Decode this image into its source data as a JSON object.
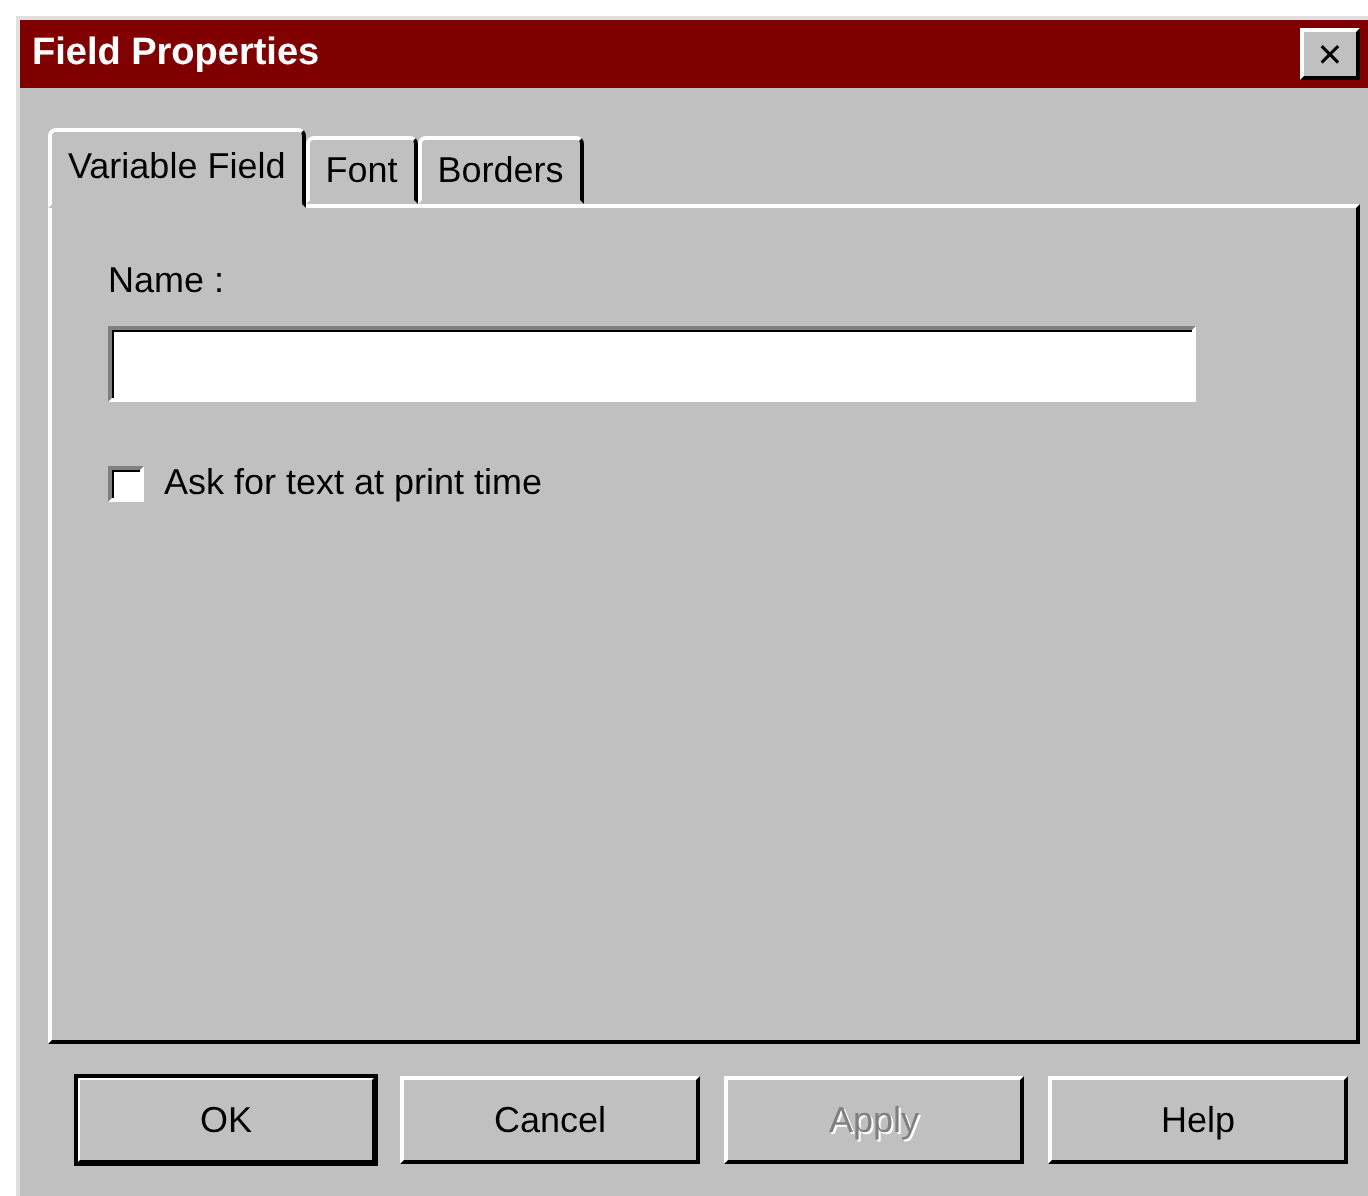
{
  "window": {
    "title": "Field Properties",
    "close": "✕"
  },
  "tabs": [
    {
      "label": "Variable Field",
      "selected": true
    },
    {
      "label": "Font",
      "selected": false
    },
    {
      "label": "Borders",
      "selected": false
    }
  ],
  "name_field": {
    "label": "Name :"
  },
  "ask_checkbox": {
    "label": "Ask for text at print time",
    "checked": false
  },
  "buttons": [
    {
      "label": "OK",
      "default": true,
      "disabled": false
    },
    {
      "label": "Cancel",
      "default": false,
      "disabled": false
    },
    {
      "label": "Apply",
      "default": false,
      "disabled": true
    },
    {
      "label": "Help",
      "default": false,
      "disabled": false
    }
  ]
}
